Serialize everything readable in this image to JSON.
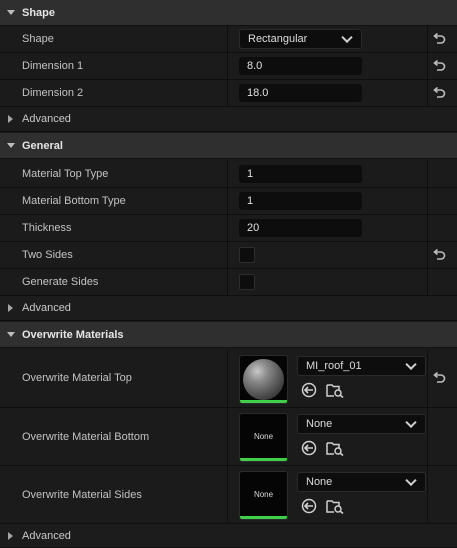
{
  "sections": {
    "shape": {
      "title": "Shape",
      "shape_label": "Shape",
      "shape_value": "Rectangular",
      "dim1_label": "Dimension 1",
      "dim1_value": "8.0",
      "dim2_label": "Dimension 2",
      "dim2_value": "18.0",
      "advanced_label": "Advanced"
    },
    "general": {
      "title": "General",
      "top_type_label": "Material Top Type",
      "top_type_value": "1",
      "bottom_type_label": "Material Bottom Type",
      "bottom_type_value": "1",
      "thickness_label": "Thickness",
      "thickness_value": "20",
      "two_sides_label": "Two Sides",
      "two_sides_checked": false,
      "generate_sides_label": "Generate Sides",
      "generate_sides_checked": false,
      "advanced_label": "Advanced"
    },
    "overwrite": {
      "title": "Overwrite Materials",
      "top_label": "Overwrite Material Top",
      "top_value": "MI_roof_01",
      "bottom_label": "Overwrite Material Bottom",
      "bottom_value": "None",
      "bottom_thumb_text": "None",
      "sides_label": "Overwrite Material Sides",
      "sides_value": "None",
      "sides_thumb_text": "None",
      "advanced_label": "Advanced"
    }
  },
  "icons": {
    "expand": "chevron-down-icon",
    "collapsed": "chevron-right-icon",
    "reset": "reset-arrow-icon",
    "use_selected": "use-selected-asset-icon",
    "browse": "browse-asset-icon"
  },
  "colors": {
    "accent_green": "#3fcf4a",
    "header_bg": "#2f2f2f",
    "row_bg": "#1b1b1b",
    "field_bg": "#0d0d0d"
  }
}
